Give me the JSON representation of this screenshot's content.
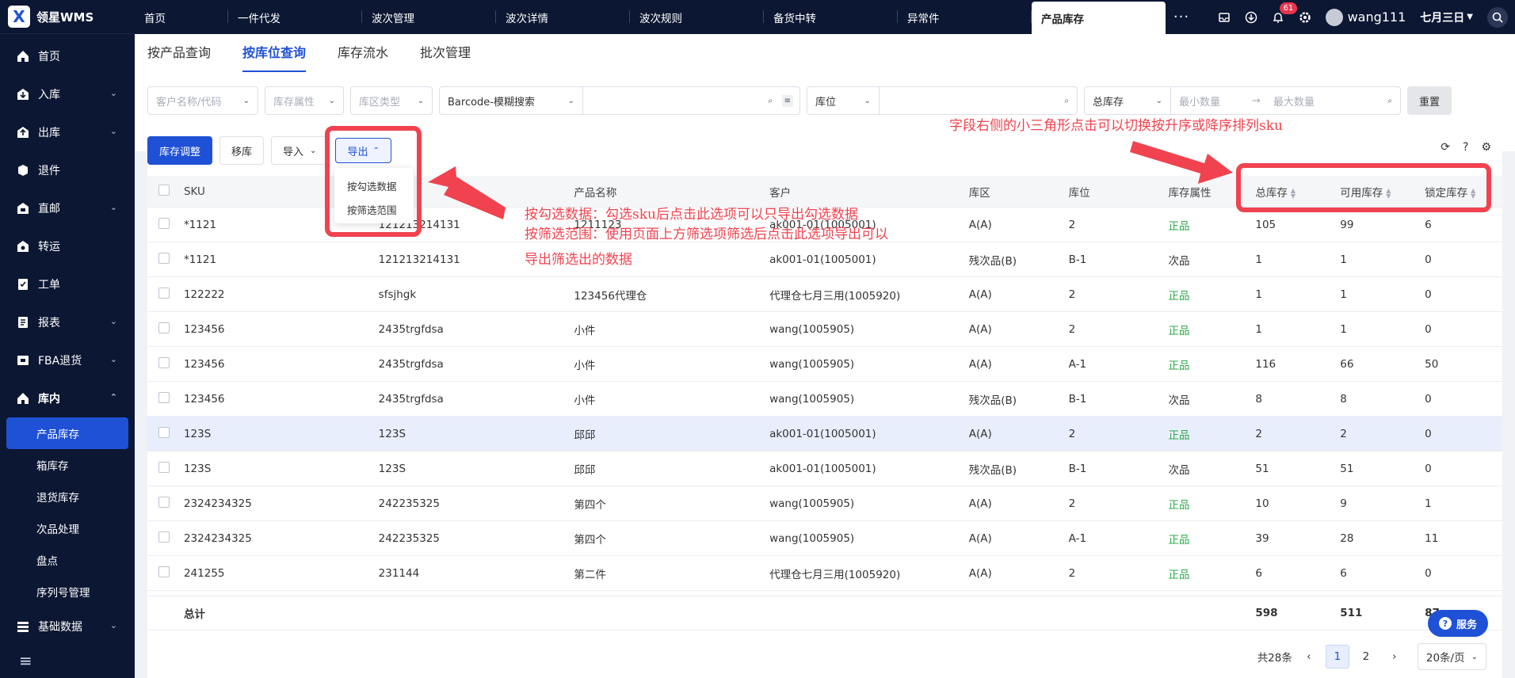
{
  "app": {
    "logo_mark": "X",
    "title": "领星WMS"
  },
  "sidebar": {
    "items": [
      {
        "label": "首页",
        "icon": "home-icon",
        "arrow": ""
      },
      {
        "label": "入库",
        "icon": "inbound-icon",
        "arrow": "⌄"
      },
      {
        "label": "出库",
        "icon": "outbound-icon",
        "arrow": "⌄"
      },
      {
        "label": "退件",
        "icon": "return-icon",
        "arrow": ""
      },
      {
        "label": "直邮",
        "icon": "mail-icon",
        "arrow": "⌄"
      },
      {
        "label": "转运",
        "icon": "transfer-icon",
        "arrow": ""
      },
      {
        "label": "工单",
        "icon": "workorder-icon",
        "arrow": ""
      },
      {
        "label": "报表",
        "icon": "report-icon",
        "arrow": "⌄"
      },
      {
        "label": "FBA退货",
        "icon": "fba-icon",
        "arrow": "⌄"
      },
      {
        "label": "库内",
        "icon": "warehouse-icon",
        "arrow": "⌃"
      }
    ],
    "subitems": [
      "产品库存",
      "箱库存",
      "退货库存",
      "次品处理",
      "盘点",
      "序列号管理"
    ],
    "bottom_item": {
      "label": "基础数据",
      "arrow": "⌄"
    },
    "collapse_icon": "≡"
  },
  "topbar": {
    "tabs": [
      "首页",
      "一件代发",
      "波次管理",
      "波次详情",
      "波次规则",
      "备货中转",
      "异常件",
      "产品库存"
    ],
    "more": "···",
    "notifications": "61",
    "user": "wang111",
    "date": "七月三日"
  },
  "subtabs": [
    "按产品查询",
    "按库位查询",
    "库存流水",
    "批次管理"
  ],
  "filters": {
    "customer": "客户名称/代码",
    "attr": "库存属性",
    "zone": "库区类型",
    "barcode": "Barcode-模糊搜索",
    "location": "库位",
    "stock": "总库存",
    "min": "最小数量",
    "max": "最大数量",
    "reset": "重置"
  },
  "toolbar": {
    "adjust": "库存调整",
    "move": "移库",
    "import": "导入",
    "export": "导出"
  },
  "export_menu": [
    "按勾选数据",
    "按筛选范围"
  ],
  "table": {
    "headers": [
      "SKU",
      "",
      "产品名称",
      "客户",
      "库区",
      "库位",
      "库存属性",
      "总库存",
      "可用库存",
      "锁定库存"
    ],
    "rows": [
      [
        "*1121",
        "121213214131",
        "1211123",
        "ak001-01(1005001)",
        "A(A)",
        "2",
        "正品",
        "105",
        "99",
        "6"
      ],
      [
        "*1121",
        "121213214131",
        "",
        "ak001-01(1005001)",
        "残次品(B)",
        "B-1",
        "次品",
        "1",
        "1",
        "0"
      ],
      [
        "122222",
        "sfsjhgk",
        "123456代理仓",
        "代理仓七月三用(1005920)",
        "A(A)",
        "2",
        "正品",
        "1",
        "1",
        "0"
      ],
      [
        "123456",
        "2435trgfdsa",
        "小件",
        "wang(1005905)",
        "A(A)",
        "2",
        "正品",
        "1",
        "1",
        "0"
      ],
      [
        "123456",
        "2435trgfdsa",
        "小件",
        "wang(1005905)",
        "A(A)",
        "A-1",
        "正品",
        "116",
        "66",
        "50"
      ],
      [
        "123456",
        "2435trgfdsa",
        "小件",
        "wang(1005905)",
        "残次品(B)",
        "B-1",
        "次品",
        "8",
        "8",
        "0"
      ],
      [
        "123S",
        "123S",
        "邱邱",
        "ak001-01(1005001)",
        "A(A)",
        "2",
        "正品",
        "2",
        "2",
        "0"
      ],
      [
        "123S",
        "123S",
        "邱邱",
        "ak001-01(1005001)",
        "残次品(B)",
        "B-1",
        "次品",
        "51",
        "51",
        "0"
      ],
      [
        "2324234325",
        "242235325",
        "第四个",
        "wang(1005905)",
        "A(A)",
        "2",
        "正品",
        "10",
        "9",
        "1"
      ],
      [
        "2324234325",
        "242235325",
        "第四个",
        "wang(1005905)",
        "A(A)",
        "A-1",
        "正品",
        "39",
        "28",
        "11"
      ],
      [
        "241255",
        "231144",
        "第二件",
        "代理仓七月三用(1005920)",
        "A(A)",
        "2",
        "正品",
        "6",
        "6",
        "0"
      ]
    ],
    "footer": {
      "label": "总计",
      "total": "598",
      "available": "511",
      "locked": "87"
    }
  },
  "pager": {
    "total": "共28条",
    "pages": [
      "1",
      "2"
    ],
    "size": "20条/页"
  },
  "service": "服务",
  "annotations": {
    "right": "字段右侧的小三角形点击可以切换按升序或降序排列sku",
    "export_1": "按勾选数据：勾选sku后点击此选项可以只导出勾选数据",
    "export_2": "按筛选范围：使用页面上方筛选项筛选后点击此选项导出可以",
    "export_3": "导出筛选出的数据"
  },
  "colors": {
    "primary": "#1f51d6",
    "nav": "#0c1733",
    "annotation": "#f0434f",
    "good": "#2da84a"
  }
}
